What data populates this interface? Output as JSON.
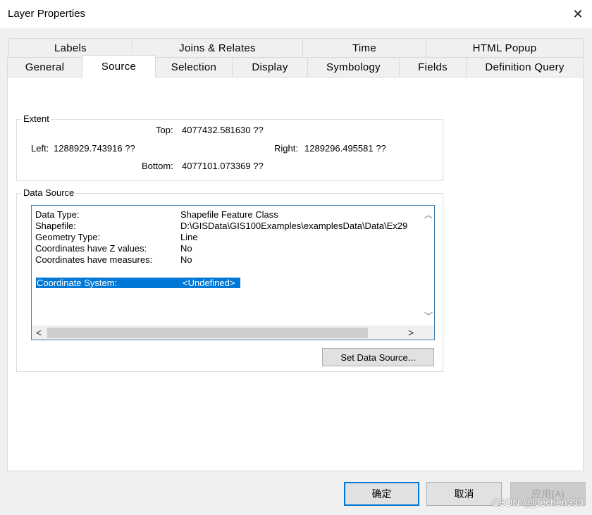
{
  "window": {
    "title": "Layer Properties"
  },
  "tabs_top": [
    {
      "label": "Labels"
    },
    {
      "label": "Joins & Relates"
    },
    {
      "label": "Time"
    },
    {
      "label": "HTML Popup"
    }
  ],
  "tabs_bottom": [
    {
      "label": "General"
    },
    {
      "label": "Source",
      "active": true
    },
    {
      "label": "Selection"
    },
    {
      "label": "Display"
    },
    {
      "label": "Symbology"
    },
    {
      "label": "Fields"
    },
    {
      "label": "Definition Query"
    }
  ],
  "extent": {
    "legend": "Extent",
    "top_label": "Top:",
    "top_value": "4077432.581630 ??",
    "left_label": "Left:",
    "left_value": "1288929.743916 ??",
    "right_label": "Right:",
    "right_value": "1289296.495581 ??",
    "bottom_label": "Bottom:",
    "bottom_value": "4077101.073369 ??"
  },
  "data_source": {
    "legend": "Data Source",
    "rows": [
      {
        "key": "Data Type:",
        "value": "Shapefile Feature Class"
      },
      {
        "key": "Shapefile:",
        "value": "D:\\GISData\\GIS100Examples\\examplesData\\Data\\Ex29"
      },
      {
        "key": "Geometry Type:",
        "value": "Line"
      },
      {
        "key": "Coordinates have Z values:",
        "value": "No"
      },
      {
        "key": "Coordinates have measures:",
        "value": "No"
      }
    ],
    "selected_row": {
      "key": "Coordinate System:",
      "value": "<Undefined>"
    },
    "set_button": "Set Data Source..."
  },
  "footer": {
    "ok": "确定",
    "cancel": "取消",
    "apply": "应用(A)"
  },
  "watermark": "CSDN @juechen333"
}
